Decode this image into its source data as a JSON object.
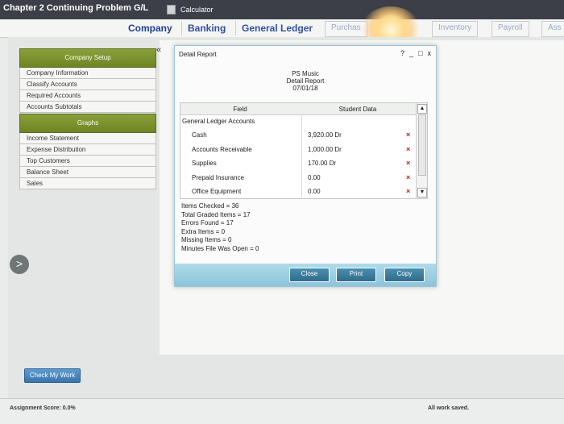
{
  "topbar": {
    "title": "Chapter 2 Continuing Problem G/L",
    "calculator": "Calculator"
  },
  "tabs": [
    {
      "label": "Company"
    },
    {
      "label": "Banking"
    },
    {
      "label": "General Ledger"
    },
    {
      "label": "Purchas"
    },
    {
      "label": "Inventory"
    },
    {
      "label": "Payroll"
    },
    {
      "label": "Ass"
    }
  ],
  "sidebar": {
    "company_setup_header": "Company Setup",
    "company_setup_items": [
      "Company Information",
      "Classify Accounts",
      "Required Accounts",
      "Accounts Subtotals"
    ],
    "graphs_header": "Graphs",
    "graph_items": [
      "Income Statement",
      "Expense Distribution",
      "Top Customers",
      "Balance Sheet",
      "Sales"
    ],
    "collapse_symbol": "«",
    "expand_symbol": ">"
  },
  "dialog": {
    "title": "Detail Report",
    "controls": [
      "?",
      "_",
      "□",
      "x"
    ],
    "report_company": "PS Music",
    "report_name": "Detail Report",
    "report_date": "07/01/18",
    "table": {
      "columns": [
        "Field",
        "Student Data"
      ],
      "group_label": "General Ledger Accounts",
      "rows": [
        {
          "field": "Cash",
          "value": "3,920.00 Dr",
          "mark": "×"
        },
        {
          "field": "Accounts Receivable",
          "value": "1,000.00 Dr",
          "mark": "×"
        },
        {
          "field": "Supplies",
          "value": "170.00 Dr",
          "mark": "×"
        },
        {
          "field": "Prepaid Insurance",
          "value": "0.00",
          "mark": "×"
        },
        {
          "field": "Office Equipment",
          "value": "0.00",
          "mark": "×"
        }
      ]
    },
    "stats": [
      "Items Checked = 36",
      "Total Graded Items = 17",
      "Errors Found = 17",
      "Extra Items = 0",
      "Missing Items = 0",
      "Minutes File Was Open = 0"
    ],
    "buttons": {
      "close": "Close",
      "print": "Print",
      "copy": "Copy"
    }
  },
  "footer": {
    "check_my_work": "Check My Work",
    "assignment_score": "Assignment Score: 0.0%",
    "saved_status": "All work saved."
  }
}
